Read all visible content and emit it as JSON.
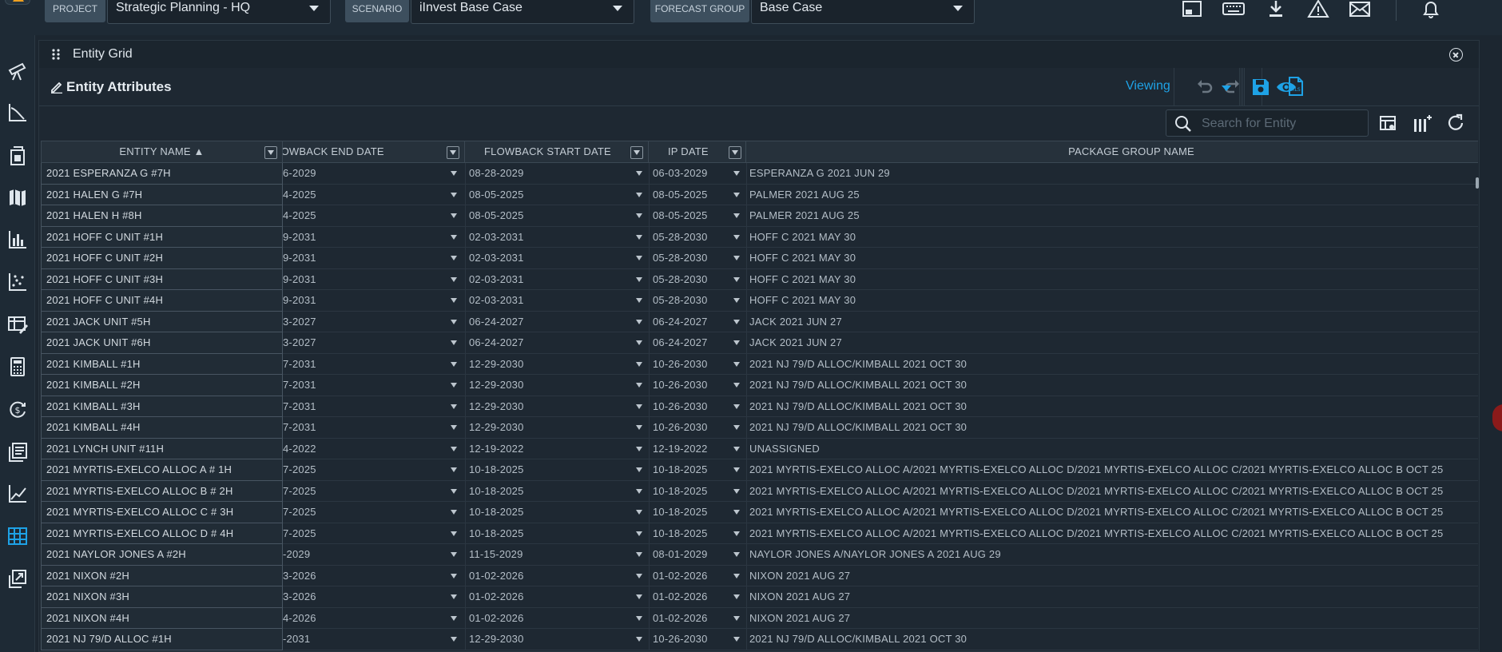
{
  "header": {
    "project_label": "PROJECT",
    "project_value": "Strategic Planning - HQ",
    "scenario_label": "SCENARIO",
    "scenario_value": "iInvest Base Case",
    "forecast_group_label": "FORECAST GROUP",
    "forecast_group_value": "Base Case",
    "icons": [
      "tablet-icon",
      "keyboard-icon",
      "download-icon",
      "warning-icon",
      "mail-icon",
      "bell-icon"
    ]
  },
  "nav": {
    "icons": [
      "telescope-icon",
      "chart-axis-icon",
      "files-icon",
      "map-icon",
      "bar-chart-icon",
      "scatter-icon",
      "table-edit-icon",
      "calculator-icon",
      "dollar-cycle-icon",
      "library-icon",
      "line-chart-icon",
      "grid-icon",
      "export-icon"
    ],
    "active": "grid-icon",
    "accent": "#1ea2e6"
  },
  "panel": {
    "title": "Entity Grid",
    "subtitle": "Entity Attributes",
    "viewing_label": "Viewing",
    "search_placeholder": "Search for Entity"
  },
  "grid": {
    "columns": [
      {
        "label": "ENTITY NAME ▲"
      },
      {
        "label": "FLOWBACK END DATE"
      },
      {
        "label": "FLOWBACK START DATE"
      },
      {
        "label": "IP DATE"
      },
      {
        "label": "PACKAGE GROUP NAME"
      }
    ],
    "rows": [
      {
        "name": "2021 ESPERANZA G #7H",
        "fb_end": "6-2029",
        "fb_start": "08-28-2029",
        "ip": "06-03-2029",
        "pkg": "ESPERANZA G 2021 JUN 29"
      },
      {
        "name": "2021 HALEN G #7H",
        "fb_end": "4-2025",
        "fb_start": "08-05-2025",
        "ip": "08-05-2025",
        "pkg": "PALMER 2021 AUG 25"
      },
      {
        "name": "2021 HALEN H #8H",
        "fb_end": "4-2025",
        "fb_start": "08-05-2025",
        "ip": "08-05-2025",
        "pkg": "PALMER 2021 AUG 25"
      },
      {
        "name": "2021 HOFF C UNIT #1H",
        "fb_end": "9-2031",
        "fb_start": "02-03-2031",
        "ip": "05-28-2030",
        "pkg": "HOFF C 2021 MAY 30"
      },
      {
        "name": "2021 HOFF C UNIT #2H",
        "fb_end": "9-2031",
        "fb_start": "02-03-2031",
        "ip": "05-28-2030",
        "pkg": "HOFF C 2021 MAY 30"
      },
      {
        "name": "2021 HOFF C UNIT #3H",
        "fb_end": "9-2031",
        "fb_start": "02-03-2031",
        "ip": "05-28-2030",
        "pkg": "HOFF C 2021 MAY 30"
      },
      {
        "name": "2021 HOFF C UNIT #4H",
        "fb_end": "9-2031",
        "fb_start": "02-03-2031",
        "ip": "05-28-2030",
        "pkg": "HOFF C 2021 MAY 30"
      },
      {
        "name": "2021 JACK UNIT #5H",
        "fb_end": "3-2027",
        "fb_start": "06-24-2027",
        "ip": "06-24-2027",
        "pkg": "JACK 2021 JUN 27"
      },
      {
        "name": "2021 JACK UNIT #6H",
        "fb_end": "3-2027",
        "fb_start": "06-24-2027",
        "ip": "06-24-2027",
        "pkg": "JACK 2021 JUN 27"
      },
      {
        "name": "2021 KIMBALL #1H",
        "fb_end": "7-2031",
        "fb_start": "12-29-2030",
        "ip": "10-26-2030",
        "pkg": "2021 NJ 79/D ALLOC/KIMBALL 2021 OCT 30"
      },
      {
        "name": "2021 KIMBALL #2H",
        "fb_end": "7-2031",
        "fb_start": "12-29-2030",
        "ip": "10-26-2030",
        "pkg": "2021 NJ 79/D ALLOC/KIMBALL 2021 OCT 30"
      },
      {
        "name": "2021 KIMBALL #3H",
        "fb_end": "7-2031",
        "fb_start": "12-29-2030",
        "ip": "10-26-2030",
        "pkg": "2021 NJ 79/D ALLOC/KIMBALL 2021 OCT 30"
      },
      {
        "name": "2021 KIMBALL #4H",
        "fb_end": "7-2031",
        "fb_start": "12-29-2030",
        "ip": "10-26-2030",
        "pkg": "2021 NJ 79/D ALLOC/KIMBALL 2021 OCT 30"
      },
      {
        "name": "2021 LYNCH UNIT #11H",
        "fb_end": "4-2022",
        "fb_start": "12-19-2022",
        "ip": "12-19-2022",
        "pkg": "UNASSIGNED"
      },
      {
        "name": "2021 MYRTIS-EXELCO ALLOC A # 1H",
        "fb_end": "7-2025",
        "fb_start": "10-18-2025",
        "ip": "10-18-2025",
        "pkg": "2021 MYRTIS-EXELCO ALLOC A/2021 MYRTIS-EXELCO ALLOC D/2021 MYRTIS-EXELCO ALLOC C/2021 MYRTIS-EXELCO ALLOC B OCT 25"
      },
      {
        "name": "2021 MYRTIS-EXELCO ALLOC B # 2H",
        "fb_end": "7-2025",
        "fb_start": "10-18-2025",
        "ip": "10-18-2025",
        "pkg": "2021 MYRTIS-EXELCO ALLOC A/2021 MYRTIS-EXELCO ALLOC D/2021 MYRTIS-EXELCO ALLOC C/2021 MYRTIS-EXELCO ALLOC B OCT 25"
      },
      {
        "name": "2021 MYRTIS-EXELCO ALLOC C # 3H",
        "fb_end": "7-2025",
        "fb_start": "10-18-2025",
        "ip": "10-18-2025",
        "pkg": "2021 MYRTIS-EXELCO ALLOC A/2021 MYRTIS-EXELCO ALLOC D/2021 MYRTIS-EXELCO ALLOC C/2021 MYRTIS-EXELCO ALLOC B OCT 25"
      },
      {
        "name": "2021 MYRTIS-EXELCO ALLOC D # 4H",
        "fb_end": "7-2025",
        "fb_start": "10-18-2025",
        "ip": "10-18-2025",
        "pkg": "2021 MYRTIS-EXELCO ALLOC A/2021 MYRTIS-EXELCO ALLOC D/2021 MYRTIS-EXELCO ALLOC C/2021 MYRTIS-EXELCO ALLOC B OCT 25"
      },
      {
        "name": "2021 NAYLOR JONES A #2H",
        "fb_end": "-2029",
        "fb_start": "11-15-2029",
        "ip": "08-01-2029",
        "pkg": "NAYLOR JONES A/NAYLOR JONES A 2021 AUG 29"
      },
      {
        "name": "2021 NIXON #2H",
        "fb_end": "3-2026",
        "fb_start": "01-02-2026",
        "ip": "01-02-2026",
        "pkg": "NIXON 2021 AUG 27"
      },
      {
        "name": "2021 NIXON #3H",
        "fb_end": "3-2026",
        "fb_start": "01-02-2026",
        "ip": "01-02-2026",
        "pkg": "NIXON 2021 AUG 27"
      },
      {
        "name": "2021 NIXON #4H",
        "fb_end": "4-2026",
        "fb_start": "01-02-2026",
        "ip": "01-02-2026",
        "pkg": "NIXON 2021 AUG 27"
      },
      {
        "name": "2021 NJ 79/D ALLOC #1H",
        "fb_end": "-2031",
        "fb_start": "12-29-2030",
        "ip": "10-26-2030",
        "pkg": "2021 NJ 79/D ALLOC/KIMBALL 2021 OCT 30"
      }
    ]
  }
}
